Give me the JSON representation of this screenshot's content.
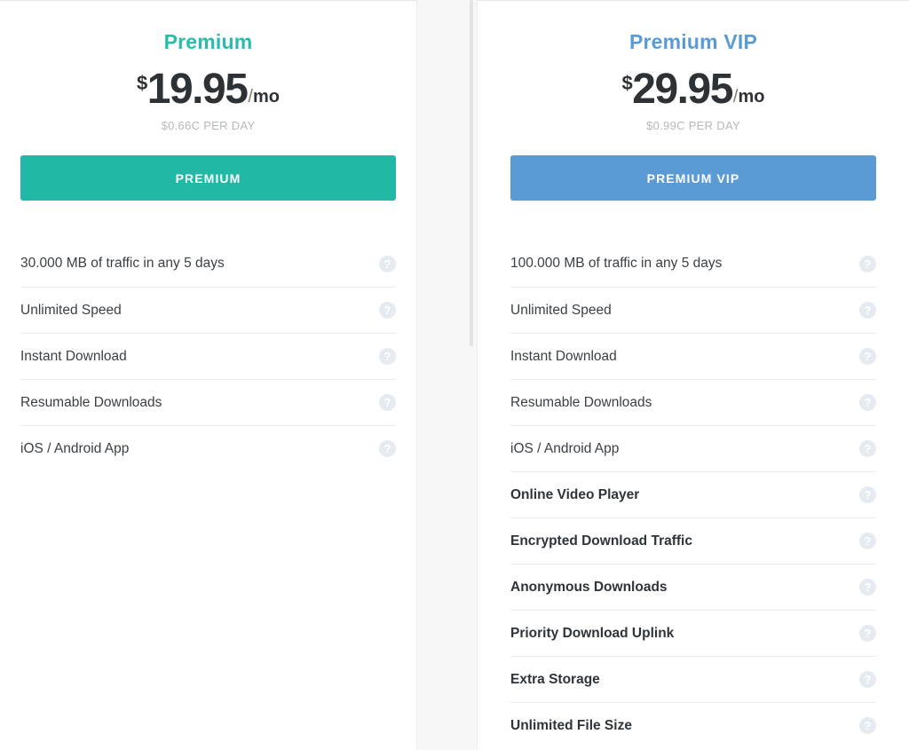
{
  "theme": {
    "teal": "#2bbbad",
    "blue": "#5b9bd5",
    "text_dark": "#3b4045",
    "muted": "#b6b9bc",
    "divider": "#ededed",
    "help_icon_bg": "#e6ebf2",
    "gutter_bg": "#f7f7f7"
  },
  "help_icon_glyph": "?",
  "plans": [
    {
      "id": "premium",
      "title": "Premium",
      "currency_symbol": "$",
      "price": "19.95",
      "slash": "/",
      "period": "mo",
      "daily_rate": "$0.66C PER DAY",
      "cta_label": "PREMIUM",
      "features": [
        {
          "label": "30.000 MB of traffic in any 5 days",
          "emphasis": false,
          "help": "?"
        },
        {
          "label": "Unlimited Speed",
          "emphasis": false,
          "help": "?"
        },
        {
          "label": "Instant Download",
          "emphasis": false,
          "help": "?"
        },
        {
          "label": "Resumable Downloads",
          "emphasis": false,
          "help": "?"
        },
        {
          "label": "iOS / Android App",
          "emphasis": false,
          "help": "?"
        }
      ]
    },
    {
      "id": "premium-vip",
      "title": "Premium VIP",
      "currency_symbol": "$",
      "price": "29.95",
      "slash": "/",
      "period": "mo",
      "daily_rate": "$0.99C PER DAY",
      "cta_label": "PREMIUM VIP",
      "features": [
        {
          "label": "100.000 MB of traffic in any 5 days",
          "emphasis": false,
          "help": "?"
        },
        {
          "label": "Unlimited Speed",
          "emphasis": false,
          "help": "?"
        },
        {
          "label": "Instant Download",
          "emphasis": false,
          "help": "?"
        },
        {
          "label": "Resumable Downloads",
          "emphasis": false,
          "help": "?"
        },
        {
          "label": "iOS / Android App",
          "emphasis": false,
          "help": "?"
        },
        {
          "label": "Online Video Player",
          "emphasis": true,
          "help": "?"
        },
        {
          "label": "Encrypted Download Traffic",
          "emphasis": true,
          "help": "?"
        },
        {
          "label": "Anonymous Downloads",
          "emphasis": true,
          "help": "?"
        },
        {
          "label": "Priority Download Uplink",
          "emphasis": true,
          "help": "?"
        },
        {
          "label": "Extra Storage",
          "emphasis": true,
          "help": "?"
        },
        {
          "label": "Unlimited File Size",
          "emphasis": true,
          "help": "?"
        }
      ]
    }
  ]
}
